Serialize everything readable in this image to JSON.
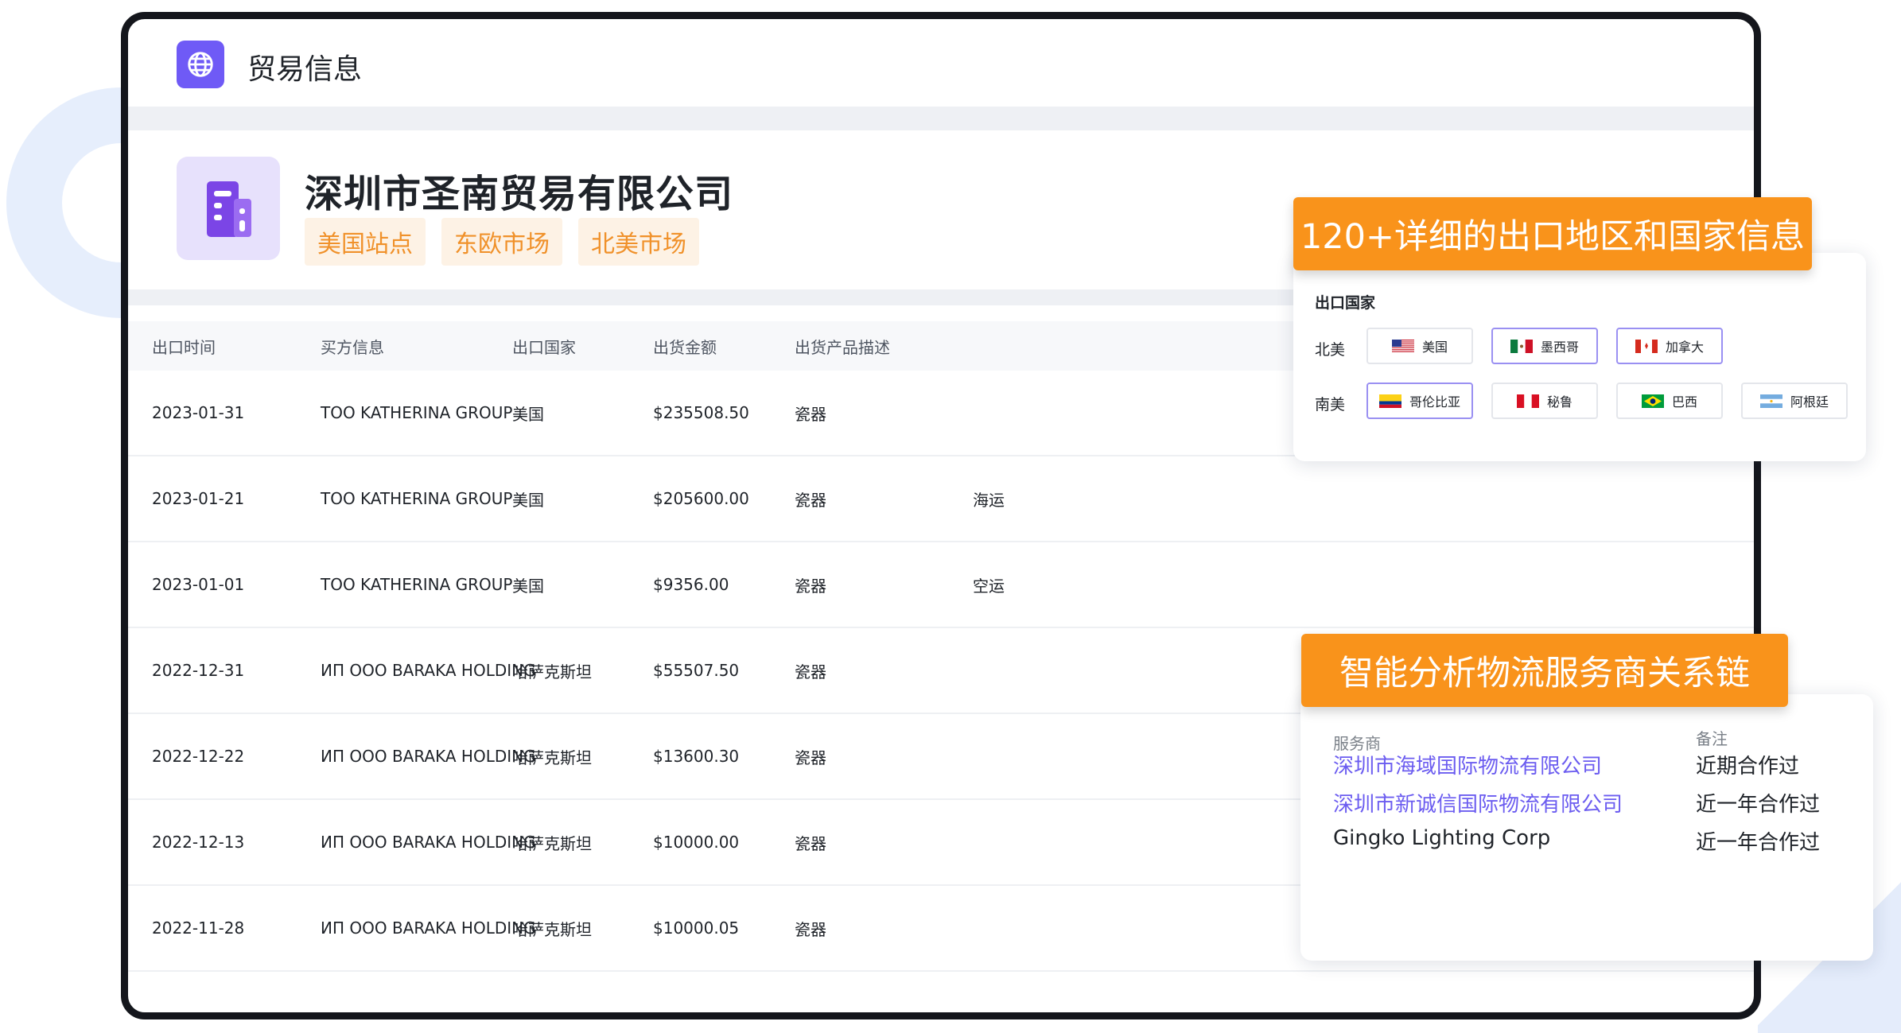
{
  "app": {
    "title": "贸易信息"
  },
  "company": {
    "name": "深圳市圣南贸易有限公司",
    "tags": [
      "美国站点",
      "东欧市场",
      "北美市场"
    ]
  },
  "table": {
    "headers": [
      "出口时间",
      "买方信息",
      "出口国家",
      "出货金额",
      "出货产品描述"
    ],
    "rows": [
      {
        "date": "2023-01-31",
        "buyer": "TOO KATHERINA GROUP",
        "country": "美国",
        "amount": "$235508.50",
        "product": "瓷器",
        "mode": ""
      },
      {
        "date": "2023-01-21",
        "buyer": "TOO KATHERINA GROUP",
        "country": "美国",
        "amount": "$205600.00",
        "product": "瓷器",
        "mode": "海运"
      },
      {
        "date": "2023-01-01",
        "buyer": "TOO KATHERINA GROUP",
        "country": "美国",
        "amount": "$9356.00",
        "product": "瓷器",
        "mode": "空运"
      },
      {
        "date": "2022-12-31",
        "buyer": "ИП ООО BARAKA HOLDING",
        "country": "哈萨克斯坦",
        "amount": "$55507.50",
        "product": "瓷器",
        "mode": ""
      },
      {
        "date": "2022-12-22",
        "buyer": "ИП ООО BARAKA HOLDING",
        "country": "哈萨克斯坦",
        "amount": "$13600.30",
        "product": "瓷器",
        "mode": ""
      },
      {
        "date": "2022-12-13",
        "buyer": "ИП ООО BARAKA HOLDING",
        "country": "哈萨克斯坦",
        "amount": "$10000.00",
        "product": "瓷器",
        "mode": ""
      },
      {
        "date": "2022-11-28",
        "buyer": "ИП ООО BARAKA HOLDING",
        "country": "哈萨克斯坦",
        "amount": "$10000.05",
        "product": "瓷器",
        "mode": ""
      }
    ]
  },
  "callout_countries": "120+详细的出口地区和国家信息",
  "countries_panel": {
    "title": "出口国家",
    "regions": [
      {
        "label": "北美",
        "countries": [
          {
            "name": "美国",
            "flag": "us",
            "selected": false
          },
          {
            "name": "墨西哥",
            "flag": "mx",
            "selected": true
          },
          {
            "name": "加拿大",
            "flag": "ca",
            "selected": true
          }
        ]
      },
      {
        "label": "南美",
        "countries": [
          {
            "name": "哥伦比亚",
            "flag": "co",
            "selected": true
          },
          {
            "name": "秘鲁",
            "flag": "pe",
            "selected": false
          },
          {
            "name": "巴西",
            "flag": "br",
            "selected": false
          },
          {
            "name": "阿根廷",
            "flag": "ar",
            "selected": false
          }
        ]
      }
    ]
  },
  "callout_logistics": "智能分析物流服务商关系链",
  "logistics_panel": {
    "headers": {
      "provider": "服务商",
      "note": "备注"
    },
    "rows": [
      {
        "provider": "深圳市海域国际物流有限公司",
        "note": "近期合作过",
        "link": true
      },
      {
        "provider": "深圳市新诚信国际物流有限公司",
        "note": "近一年合作过",
        "link": true
      },
      {
        "provider": "Gingko Lighting Corp",
        "note": "近一年合作过",
        "link": false
      }
    ]
  },
  "colors": {
    "accent": "#6f5af6",
    "callout": "#f9931b",
    "tag_text": "#f0912a",
    "link": "#6b5cf0"
  }
}
